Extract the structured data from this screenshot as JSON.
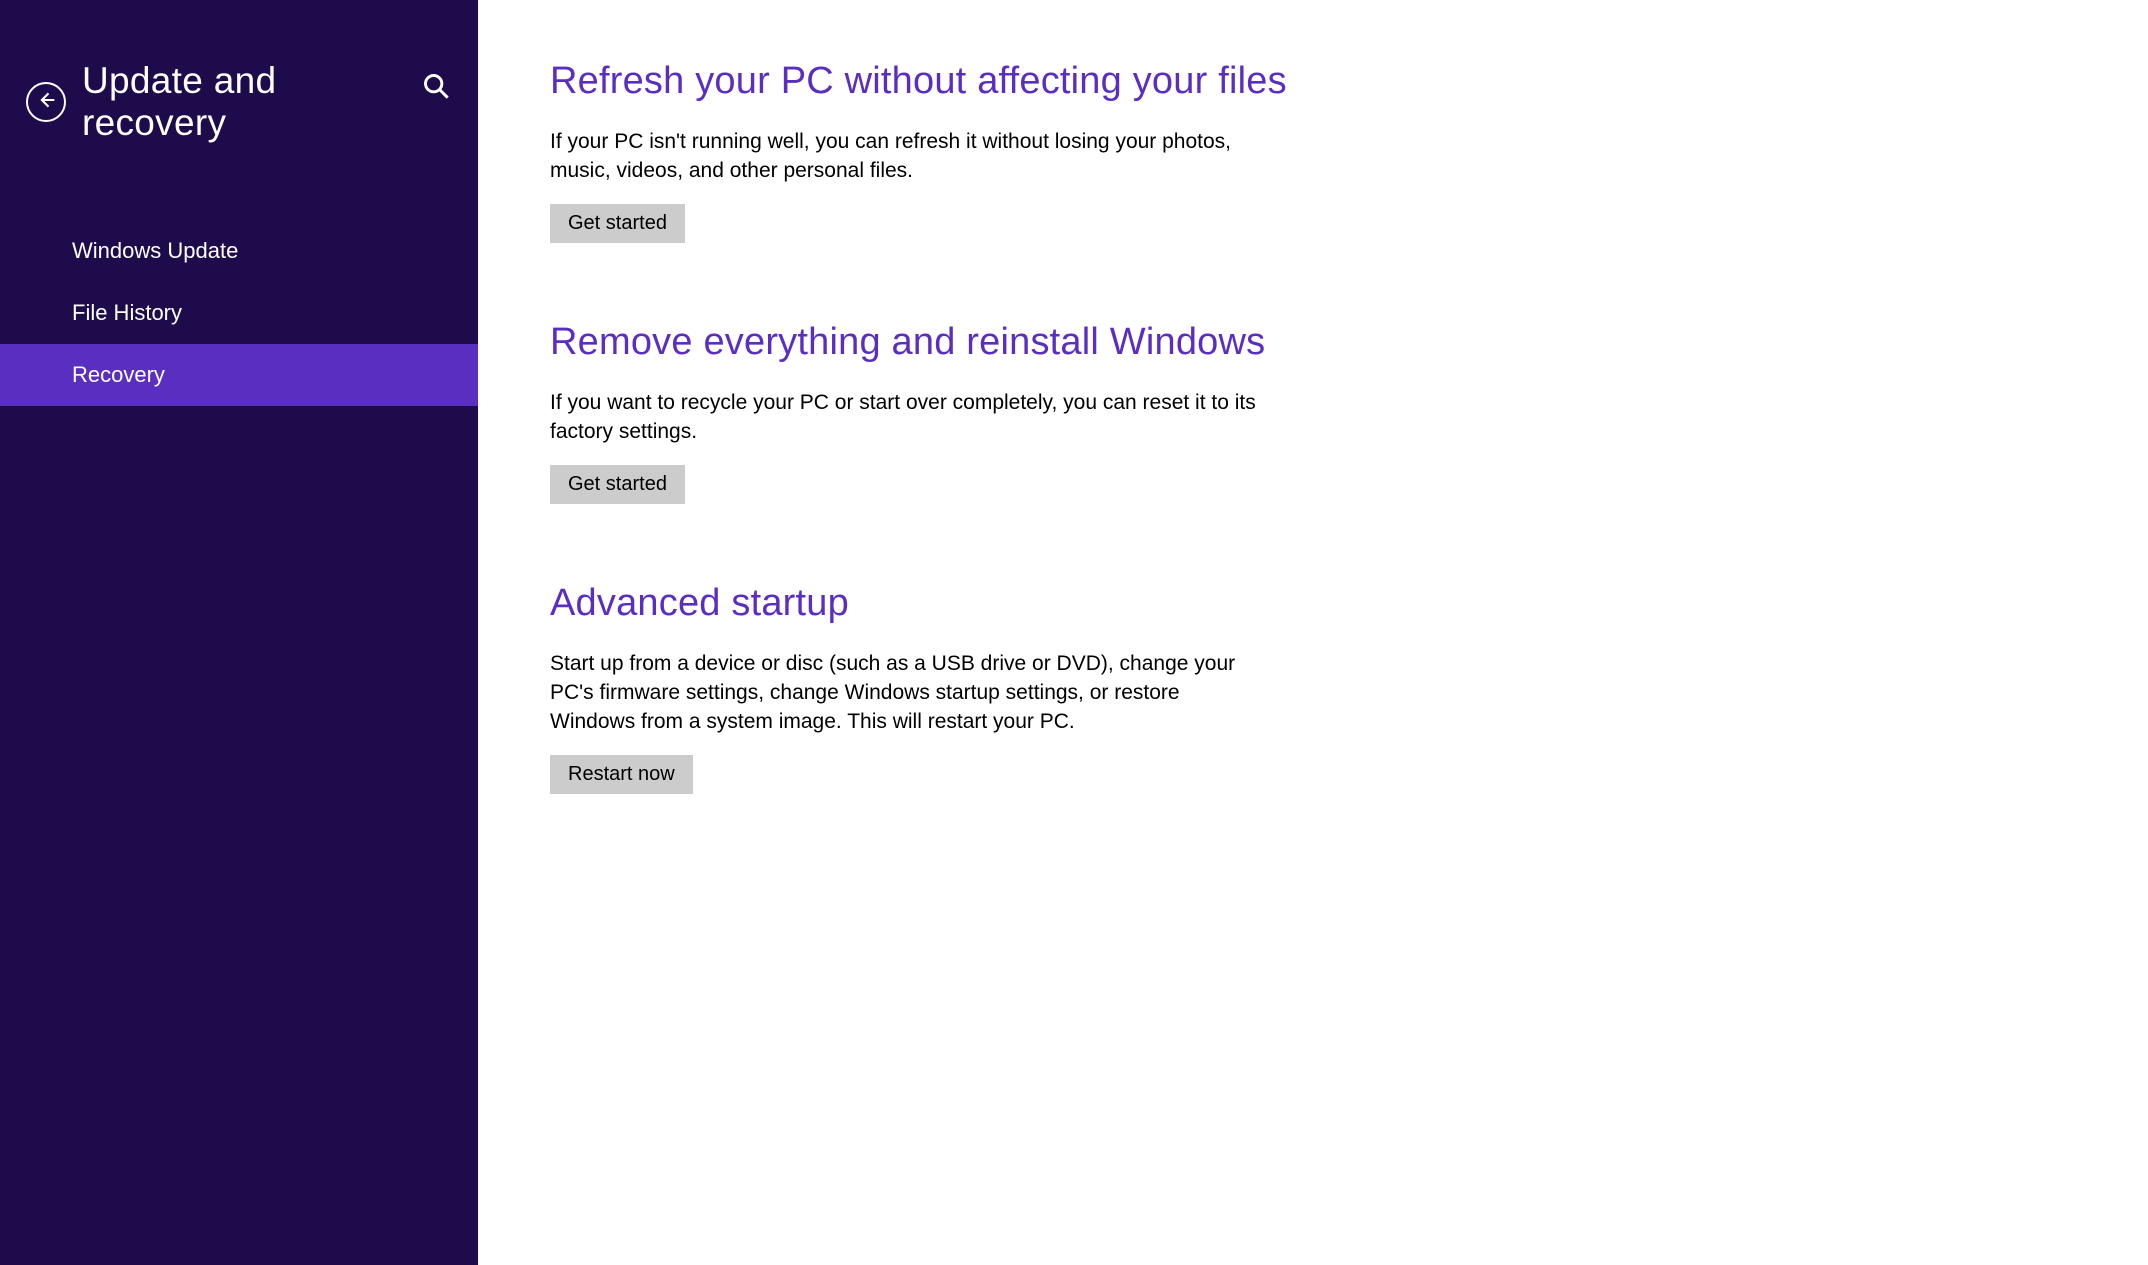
{
  "header": {
    "title": "Update and recovery"
  },
  "sidebar": {
    "items": [
      {
        "label": "Windows Update",
        "active": false
      },
      {
        "label": "File History",
        "active": false
      },
      {
        "label": "Recovery",
        "active": true
      }
    ]
  },
  "main": {
    "sections": [
      {
        "title": "Refresh your PC without affecting your files",
        "description": "If your PC isn't running well, you can refresh it without losing your photos, music, videos, and other personal files.",
        "button": "Get started"
      },
      {
        "title": "Remove everything and reinstall Windows",
        "description": "If you want to recycle your PC or start over completely, you can reset it to its factory settings.",
        "button": "Get started"
      },
      {
        "title": "Advanced startup",
        "description": "Start up from a device or disc (such as a USB drive or DVD), change your PC's firmware settings, change Windows startup settings, or restore Windows from a system image. This will restart your PC.",
        "button": "Restart now"
      }
    ]
  },
  "colors": {
    "sidebar_bg": "#1e0b4b",
    "accent": "#5b2ec2",
    "button_bg": "#cccccc"
  }
}
